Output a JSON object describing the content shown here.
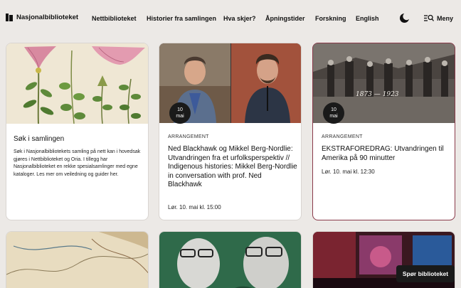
{
  "header": {
    "logo_text": "Nasjonalbiblioteket",
    "nav": [
      "Nettbiblioteket",
      "Historier fra samlingen",
      "Hva skjer?",
      "Åpningstider",
      "Forskning",
      "English"
    ],
    "menu_label": "Meny"
  },
  "cards": [
    {
      "title": "Søk i samlingen",
      "description": "Søk i Nasjonalbibliotekets samling på nett kan i hovedsak gjøres i Nettbiblioteket og Oria. I tillegg har Nasjonalbiblioteket en rekke spesialsamlinger med egne kataloger. Les mer om veiledning og guider her."
    },
    {
      "date_day": "10",
      "date_month": "mai",
      "kicker": "ARRANGEMENT",
      "title": "Ned Blackhawk og Mikkel Berg-Nordlie: Utvandringen fra et urfolksperspektiv // Indigenous histories: Mikkel Berg-Nordlie in conversation with prof. Ned Blackhawk",
      "meta": "Lør. 10. mai kl. 15:00"
    },
    {
      "date_day": "10",
      "date_month": "mai",
      "kicker": "ARRANGEMENT",
      "title": "EKSTRAFOREDRAG: Utvandringen til Amerika på 90 minutter",
      "meta": "Lør. 10. mai kl. 12:30",
      "photo_caption": "1873 — 1923"
    }
  ],
  "chat_button": "Spør biblioteket",
  "colors": {
    "background": "#ece9e6",
    "accent_border": "#8a3a4a",
    "badge": "#1a1a1a"
  }
}
